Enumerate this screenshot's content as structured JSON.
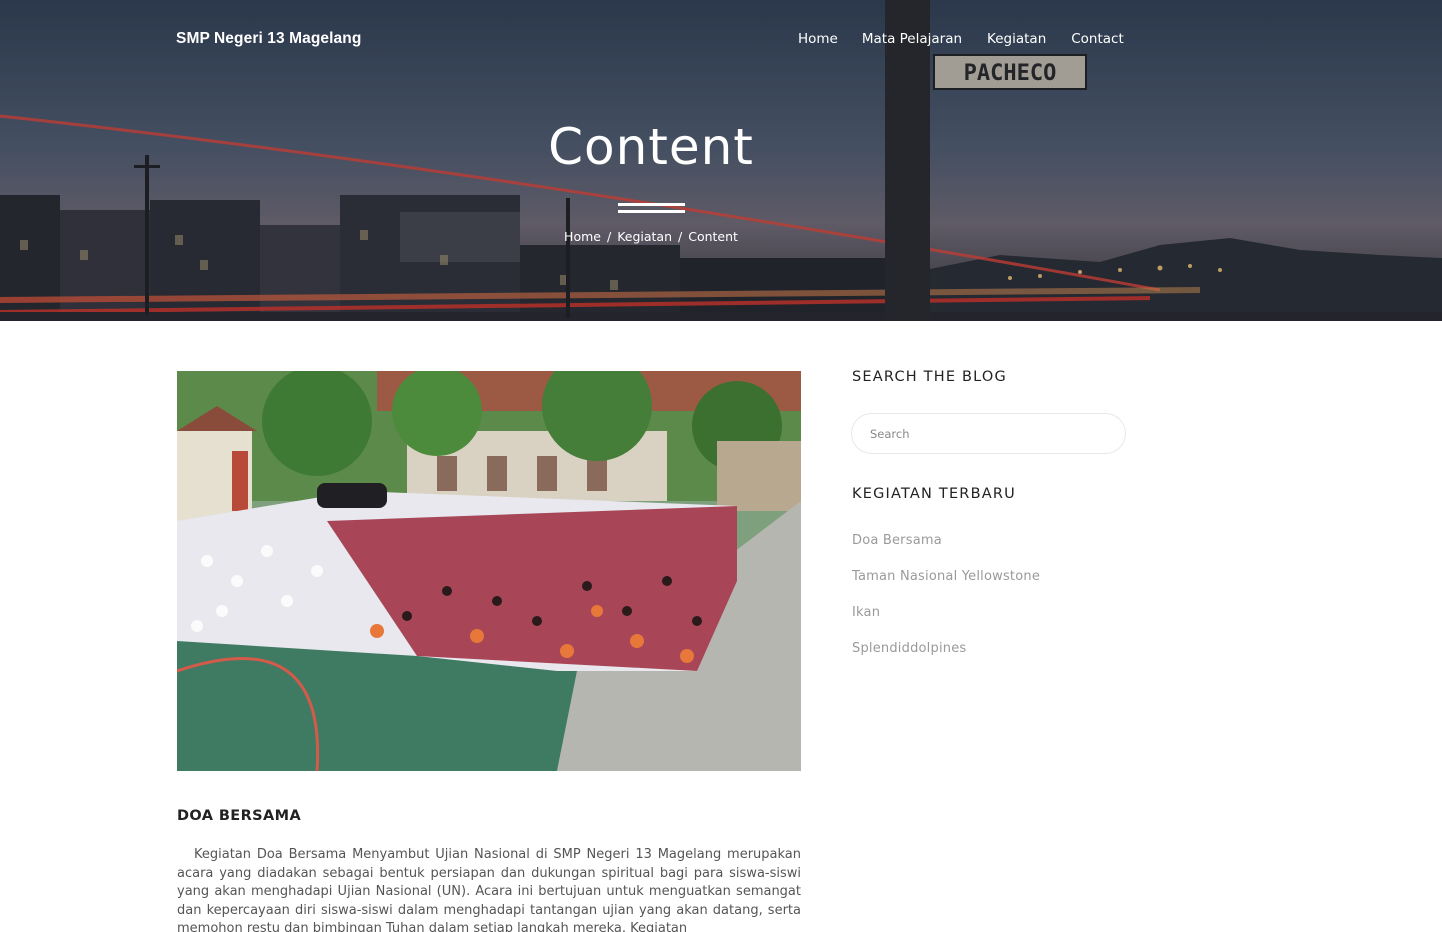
{
  "site": {
    "brand": "SMP Negeri 13 Magelang",
    "nav": [
      "Home",
      "Mata Pelajaran",
      "Kegiatan",
      "Contact"
    ]
  },
  "hero": {
    "title": "Content",
    "sign_text": "PACHECO",
    "breadcrumb": [
      "Home",
      "Kegiatan",
      "Content"
    ],
    "breadcrumb_separator": "/"
  },
  "post": {
    "image_alt": "Doa Bersama",
    "title": "DOA BERSAMA",
    "body": "Kegiatan Doa Bersama Menyambut Ujian Nasional di SMP Negeri 13 Magelang merupakan acara yang diadakan sebagai bentuk persiapan dan dukungan spiritual bagi para siswa-siswi yang akan menghadapi Ujian Nasional (UN). Acara ini bertujuan untuk menguatkan semangat dan kepercayaan diri siswa-siswi dalam menghadapi tantangan ujian yang akan datang, serta memohon restu dan bimbingan Tuhan dalam setiap langkah mereka. Kegiatan"
  },
  "sidebar": {
    "search_heading": "SEARCH THE BLOG",
    "search_placeholder": "Search",
    "recent_heading": "KEGIATAN TERBARU",
    "recent_items": [
      "Doa Bersama",
      "Taman Nasional Yellowstone",
      "Ikan",
      "Splendiddolpines"
    ]
  },
  "colors": {
    "white": "#ffffff",
    "heading": "#222222",
    "body_text": "#555555",
    "muted_link": "#9a9a9a"
  }
}
